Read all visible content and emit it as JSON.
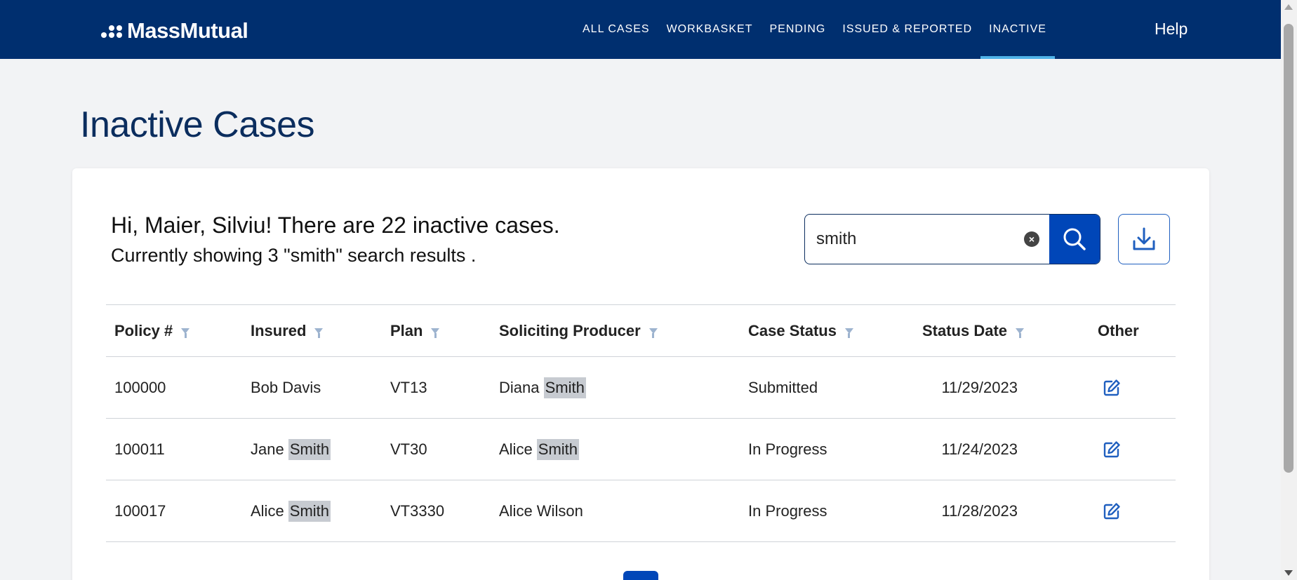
{
  "header": {
    "brand": "MassMutual",
    "nav": [
      {
        "label": "ALL CASES",
        "active": false
      },
      {
        "label": "WORKBASKET",
        "active": false
      },
      {
        "label": "PENDING",
        "active": false
      },
      {
        "label": "ISSUED & REPORTED",
        "active": false
      },
      {
        "label": "INACTIVE",
        "active": true
      }
    ],
    "help": "Help"
  },
  "page": {
    "title": "Inactive Cases",
    "greeting_prefix": "Hi, Maier, Silviu! There are ",
    "greeting_count": "22",
    "greeting_suffix": " inactive cases.",
    "subline": "Currently showing 3 \"smith\" search results ."
  },
  "search": {
    "value": "smith",
    "clear_label": "×"
  },
  "table": {
    "headers": [
      "Policy #",
      "Insured",
      "Plan",
      "Soliciting Producer",
      "Case Status",
      "Status Date",
      "Other"
    ],
    "highlight_term": "Smith",
    "rows": [
      {
        "policy": "100000",
        "insured": [
          "Bob Davis",
          ""
        ],
        "plan": "VT13",
        "producer": [
          "Diana ",
          "Smith"
        ],
        "status": "Submitted",
        "date": "11/29/2023"
      },
      {
        "policy": "100011",
        "insured": [
          "Jane ",
          "Smith"
        ],
        "plan": "VT30",
        "producer": [
          "Alice ",
          "Smith"
        ],
        "status": "In Progress",
        "date": "11/24/2023"
      },
      {
        "policy": "100017",
        "insured": [
          "Alice ",
          "Smith"
        ],
        "plan": "VT3330",
        "producer": [
          "Alice Wilson",
          ""
        ],
        "status": "In Progress",
        "date": "11/28/2023"
      }
    ]
  },
  "colors": {
    "header_bg": "#002f6f",
    "accent": "#4fb3e8",
    "primary_button": "#0046b8",
    "title": "#0b2d5e"
  },
  "icons": {
    "search": "search-icon",
    "download": "download-icon",
    "edit": "edit-icon",
    "clear": "clear-icon",
    "filter": "filter-icon"
  }
}
